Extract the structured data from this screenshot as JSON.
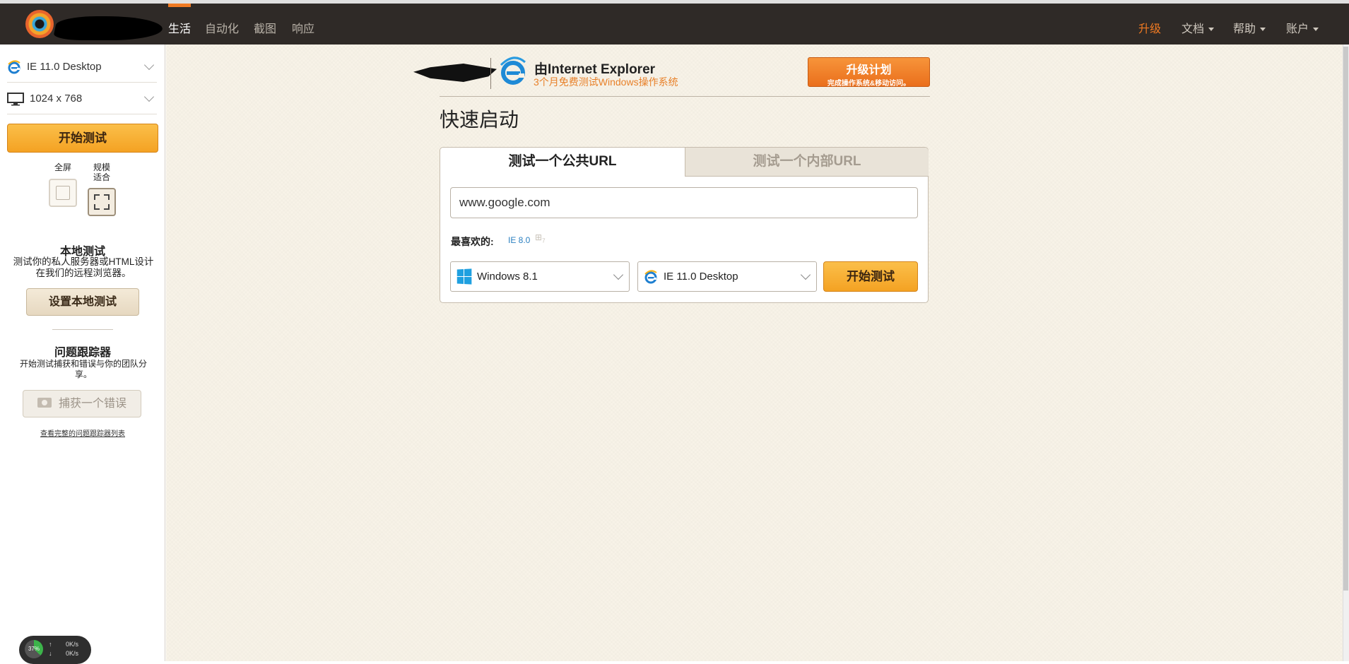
{
  "nav": {
    "items": [
      "生活",
      "自动化",
      "截图",
      "响应"
    ],
    "right": {
      "upgrade": "升级",
      "docs": "文档",
      "help": "帮助",
      "account": "账户"
    }
  },
  "sidebar": {
    "browser": "IE 11.0 Desktop",
    "resolution": "1024 x 768",
    "start": "开始测试",
    "mode_fullscreen": "全屏",
    "mode_fit": "规模适合",
    "local_title": "本地测试",
    "local_text": "测试你的私人服务器或HTML设计在我们的远程浏览器。",
    "local_button": "设置本地测试",
    "tracker_title": "问题跟踪器",
    "tracker_text": "开始测试捕获和错误与你的团队分享。",
    "capture_button": "捕获一个错误",
    "tracker_link": "查看完整的问题跟踪器列表"
  },
  "promo": {
    "title": "由Internet Explorer",
    "subtitle": "3个月免费测试Windows操作系统",
    "upgrade_title": "升级计划",
    "upgrade_sub": "完成操作系统&移动访问。"
  },
  "quickstart": {
    "title": "快速启动",
    "tab_public": "测试一个公共URL",
    "tab_internal": "测试一个内部URL",
    "url_value": "www.google.com",
    "fav_label": "最喜欢的:",
    "fav_item": "IE 8.0",
    "fav_os_badge": "7",
    "os": "Windows 8.1",
    "browser": "IE 11.0 Desktop",
    "start": "开始测试"
  },
  "netwidget": {
    "percent": "37%",
    "up": "0K/s",
    "down": "0K/s"
  },
  "colors": {
    "accent": "#f07a22",
    "nav_bg": "#2f2a27",
    "button": "#f4a223"
  }
}
